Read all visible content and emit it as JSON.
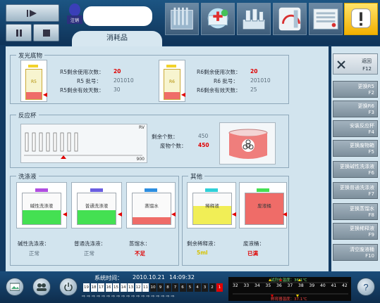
{
  "screen_title": "消耗品",
  "user_badge": "注销",
  "substrate": {
    "title": "发光底物",
    "r5": {
      "bottle_label": "R5",
      "uses_label": "R5剩余使用次数：",
      "uses_value": "20",
      "lot_label": "R5 批号：",
      "lot_value": "201010",
      "days_label": "R5剩余有效天数：",
      "days_value": "30"
    },
    "r6": {
      "bottle_label": "R6",
      "uses_label": "R6剩余使用次数：",
      "uses_value": "20",
      "lot_label": "R6 批号：",
      "lot_value": "201010",
      "days_label": "R6剩余有效天数：",
      "days_value": "25"
    }
  },
  "cuvette": {
    "title": "反应杯",
    "rv_label": "RV",
    "scale_max": "900",
    "remaining_label": "剩余个数：",
    "remaining_value": "450",
    "waste_label": "废物个数：",
    "waste_value": "450"
  },
  "wash": {
    "title": "洗涤液",
    "alkaline": {
      "tank_label": "碱性洗涤液",
      "label": "碱性洗涤液：",
      "status": "正常",
      "fill_color": "#44e052",
      "cap_color": "#b04de0"
    },
    "normal": {
      "tank_label": "普通洗涤液",
      "label": "普通洗涤液：",
      "status": "正常",
      "fill_color": "#44e052",
      "cap_color": "#6a5ee0"
    },
    "water": {
      "tank_label": "蒸馏水",
      "label": "蒸馏水：",
      "status": "不足",
      "fill_color": "#ef6c68",
      "cap_color": "#2c8ee0"
    }
  },
  "other": {
    "title": "其他",
    "diluent": {
      "tank_label": "稀释液",
      "label": "剩余稀释液：",
      "value": "5ml",
      "fill_color": "#f1ee56",
      "cap_color": "#2fd0d8"
    },
    "waste": {
      "tank_label": "废液桶",
      "label": "废液桶：",
      "status": "已满",
      "fill_color": "#ef6c68",
      "cap_color": "#44e052"
    }
  },
  "right_buttons": {
    "return": {
      "label": "返回",
      "key": "F12"
    },
    "items": [
      {
        "label": "更换R5",
        "key": "F2"
      },
      {
        "label": "更换R6",
        "key": "F3"
      },
      {
        "label": "安装反应杯",
        "key": "F4"
      },
      {
        "label": "更换废物箱",
        "key": "F5"
      },
      {
        "label": "更换碱性洗涤液",
        "key": "F6"
      },
      {
        "label": "更换普通洗涤液",
        "key": "F7"
      },
      {
        "label": "更换蒸馏水",
        "key": "F8"
      },
      {
        "label": "更换稀释液",
        "key": "F9"
      },
      {
        "label": "清空废液桶",
        "key": "F10"
      }
    ]
  },
  "status_bar": {
    "time_label": "系统时间：",
    "date": "2010.10.21",
    "time": "14:09:32",
    "cells": [
      "19",
      "18",
      "17",
      "16",
      "15",
      "14",
      "13",
      "12",
      "11",
      "10",
      "9",
      "8",
      "7",
      "6",
      "5",
      "4",
      "3",
      "2",
      "1"
    ],
    "scale_title": "试剂仓温度：36.1℃",
    "scale_ticks": [
      "32",
      "33",
      "34",
      "35",
      "36",
      "37",
      "38",
      "39",
      "40",
      "41",
      "42"
    ],
    "scale_bottom": "孵育器温度：37.1℃"
  },
  "colors": {
    "accent": "#e00000",
    "panel_bg": "#d2e4ee",
    "header_bg": "#1c5583"
  }
}
